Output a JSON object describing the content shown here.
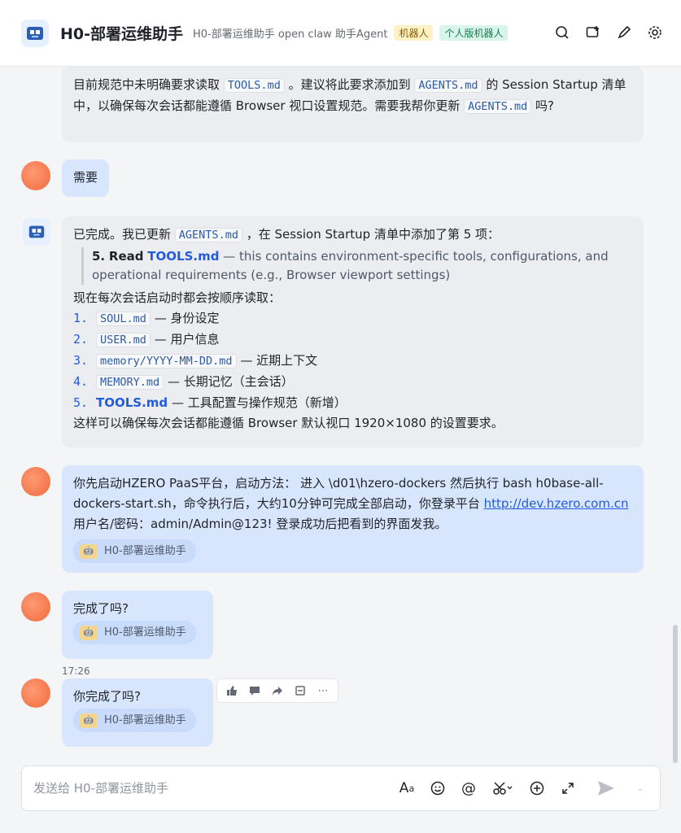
{
  "header": {
    "title": "H0-部署运维助手",
    "subtitle": "H0-部署运维助手 open claw 助手Agent",
    "tag_bot": "机器人",
    "tag_personal": "个人版机器人",
    "colors": {
      "tag_bot_bg": "#fdf1c7",
      "tag_personal_bg": "#d9f5ea"
    },
    "action_icons": [
      "search-icon",
      "add-tab-icon",
      "pen-icon",
      "settings-icon"
    ]
  },
  "messages": {
    "m1": {
      "p1": "目前规范中未明确要求读取",
      "code1": "TOOLS.md",
      "p2": "。建议将此要求添加到",
      "code2": "AGENTS.md",
      "p3": "的 Session Startup 清单中，以确保每次会话都能遵循 Browser 视口设置规范。需要我帮你更新",
      "code3": "AGENTS.md",
      "p4": "吗?"
    },
    "m2": {
      "text": "需要"
    },
    "m3": {
      "p1": "已完成。我已更新",
      "code1": "AGENTS.md",
      "p2": "，在 Session Startup 清单中添加了第 5 项：",
      "quote_num": "5.",
      "quote_read": "Read",
      "quote_file": "TOOLS.md",
      "quote_rest": "— this contains environment-specific tools, configurations, and operational requirements (e.g., Browser viewport settings)",
      "intro": "现在每次会话启动时都会按顺序读取：",
      "items": [
        {
          "num": "1.",
          "code": "SOUL.md",
          "desc": "— 身份设定"
        },
        {
          "num": "2.",
          "code": "USER.md",
          "desc": "— 用户信息"
        },
        {
          "num": "3.",
          "code": "memory/YYYY-MM-DD.md",
          "desc": "— 近期上下文"
        },
        {
          "num": "4.",
          "code": "MEMORY.md",
          "desc": "— 长期记忆（主会话）"
        },
        {
          "num": "5.",
          "code": "TOOLS.md",
          "desc": "— 工具配置与操作规范（新增）"
        }
      ],
      "outro": "这样可以确保每次会话都能遵循 Browser 默认视口 1920×1080 的设置要求。"
    },
    "m4": {
      "p1": "你先启动HZERO PaaS平台，启动方法： 进入 \\d01\\hzero-dockers 然后执行 bash h0base-all-dockers-start.sh，命令执行后，大约10分钟可完成全部启动，你登录平台",
      "link": "http://dev.hzero.com.cn",
      "p2": "用户名/密码：admin/Admin@123!   登录成功后把看到的界面发我。",
      "chip": "H0-部署运维助手"
    },
    "m5": {
      "text": "完成了吗?",
      "chip": "H0-部署运维助手"
    },
    "m6": {
      "time": "17:26",
      "text": "你完成了吗?",
      "chip": "H0-部署运维助手"
    }
  },
  "toolbar_icons": [
    "thumbs-up-icon",
    "comment-icon",
    "forward-icon",
    "pin-icon",
    "more-icon"
  ],
  "composer": {
    "placeholder": "发送给 H0-部署运维助手",
    "tools": [
      "font-icon",
      "emoji-icon",
      "mention-icon",
      "scissors-icon",
      "add-icon",
      "expand-icon",
      "send-icon"
    ]
  }
}
